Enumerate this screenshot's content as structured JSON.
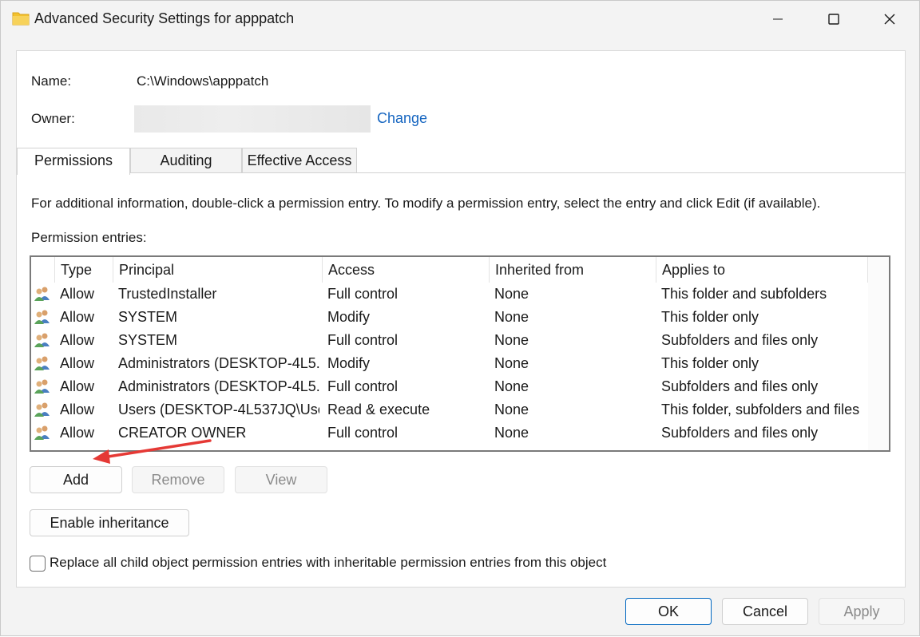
{
  "window": {
    "title": "Advanced Security Settings for apppatch",
    "icon": "folder-icon",
    "controls": [
      "minimize-icon",
      "maximize-icon",
      "close-icon"
    ]
  },
  "info": {
    "name_label": "Name:",
    "name_value": "C:\\Windows\\apppatch",
    "owner_label": "Owner:",
    "owner_value": "",
    "change_link": "Change"
  },
  "tabs": [
    {
      "label": "Permissions",
      "active": true
    },
    {
      "label": "Auditing",
      "active": false
    },
    {
      "label": "Effective Access",
      "active": false
    }
  ],
  "permissions": {
    "info_text": "For additional information, double-click a permission entry. To modify a permission entry, select the entry and click Edit (if available).",
    "entries_label": "Permission entries:",
    "columns": [
      "Type",
      "Principal",
      "Access",
      "Inherited from",
      "Applies to"
    ],
    "rows": [
      {
        "type": "Allow",
        "principal": "TrustedInstaller",
        "access": "Full control",
        "inherited": "None",
        "applies": "This folder and subfolders"
      },
      {
        "type": "Allow",
        "principal": "SYSTEM",
        "access": "Modify",
        "inherited": "None",
        "applies": "This folder only"
      },
      {
        "type": "Allow",
        "principal": "SYSTEM",
        "access": "Full control",
        "inherited": "None",
        "applies": "Subfolders and files only"
      },
      {
        "type": "Allow",
        "principal": "Administrators (DESKTOP-4L5...",
        "access": "Modify",
        "inherited": "None",
        "applies": "This folder only"
      },
      {
        "type": "Allow",
        "principal": "Administrators (DESKTOP-4L5...",
        "access": "Full control",
        "inherited": "None",
        "applies": "Subfolders and files only"
      },
      {
        "type": "Allow",
        "principal": "Users (DESKTOP-4L537JQ\\Use...",
        "access": "Read & execute",
        "inherited": "None",
        "applies": "This folder, subfolders and files"
      },
      {
        "type": "Allow",
        "principal": "CREATOR OWNER",
        "access": "Full control",
        "inherited": "None",
        "applies": "Subfolders and files only"
      }
    ]
  },
  "buttons": {
    "add": "Add",
    "remove": "Remove",
    "view": "View",
    "enable_inheritance": "Enable inheritance",
    "ok": "OK",
    "cancel": "Cancel",
    "apply": "Apply"
  },
  "replace_checkbox": {
    "label": "Replace all child object permission entries with inheritable permission entries from this object",
    "checked": false
  },
  "annotation": {
    "color": "#e53935"
  }
}
